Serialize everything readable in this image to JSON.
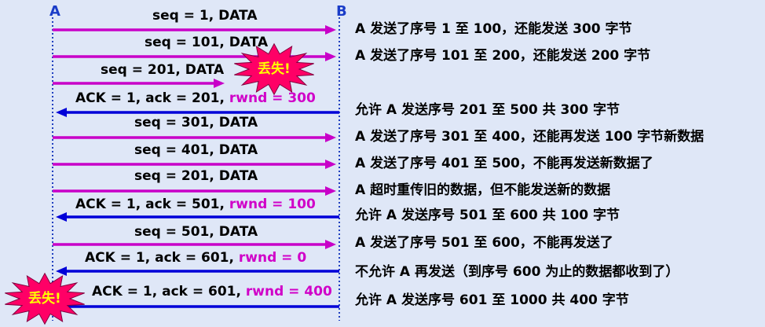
{
  "hosts": {
    "a": "A",
    "b": "B"
  },
  "lost_label": "丢失!",
  "colors": {
    "data_arrow": "#c800c8",
    "ack_arrow": "#0000d8",
    "rwnd_text": "#d000c8",
    "host_text": "#1a3cc8",
    "burst_fill": "#ff0066",
    "burst_text": "#ffff00"
  },
  "messages": [
    {
      "kind": "data",
      "label": "seq = 1, DATA",
      "desc": "A 发送了序号 1 至 100，还能发送 300 字节"
    },
    {
      "kind": "data",
      "label": "seq = 101, DATA",
      "desc": "A 发送了序号 101 至 200，还能发送 200 字节"
    },
    {
      "kind": "data",
      "label": "seq = 201, DATA",
      "lost": true,
      "desc": ""
    },
    {
      "kind": "ack",
      "label": "ACK = 1, ack = 201, ",
      "rwnd": "rwnd = 300",
      "desc": "允许 A 发送序号 201 至 500  共 300 字节"
    },
    {
      "kind": "data",
      "label": "seq = 301, DATA",
      "desc": "A 发送了序号 301 至 400，还能再发送 100 字节新数据"
    },
    {
      "kind": "data",
      "label": "seq = 401, DATA",
      "desc": "A 发送了序号 401 至 500，不能再发送新数据了"
    },
    {
      "kind": "data",
      "label": "seq = 201, DATA",
      "desc": "A 超时重传旧的数据，但不能发送新的数据"
    },
    {
      "kind": "ack",
      "label": "ACK = 1, ack = 501, ",
      "rwnd": "rwnd = 100",
      "desc": "允许 A 发送序号 501 至 600 共 100 字节"
    },
    {
      "kind": "data",
      "label": "seq = 501, DATA",
      "desc": "A 发送了序号 501 至 600，不能再发送了"
    },
    {
      "kind": "ack",
      "label": "ACK = 1, ack = 601, ",
      "rwnd": "rwnd = 0",
      "desc": "不允许 A 再发送（到序号 600 为止的数据都收到了）"
    },
    {
      "kind": "ack",
      "label": "ACK = 1, ack = 601, ",
      "rwnd": "rwnd = 400",
      "desc": "允许 A 发送序号 601 至 1000  共 400 字节",
      "lost": true
    }
  ]
}
